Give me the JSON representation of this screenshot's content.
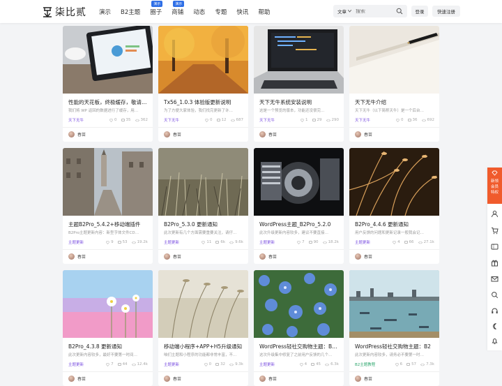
{
  "header": {
    "logo_text": "柒比贰",
    "nav": [
      {
        "label": "演示",
        "badge": ""
      },
      {
        "label": "B2主题",
        "badge": ""
      },
      {
        "label": "圈子",
        "badge": "演示"
      },
      {
        "label": "商铺",
        "badge": "演示"
      },
      {
        "label": "动态",
        "badge": ""
      },
      {
        "label": "专题",
        "badge": ""
      },
      {
        "label": "快讯",
        "badge": ""
      },
      {
        "label": "帮助",
        "badge": ""
      }
    ],
    "search": {
      "type": "文章",
      "placeholder": "搜索"
    },
    "login": "登录",
    "register": "快速注册"
  },
  "cards": [
    {
      "title": "性能的天花板，终极缓存，敬请期待！",
      "desc": "我们将 WP 返回的数据进行了缓存，用…",
      "cat": "天下无牛",
      "stats": [
        "0",
        "35",
        "362"
      ],
      "author": "春苗",
      "thumb": "tablet"
    },
    {
      "title": "Tx56_1.0.3 体验版更新说明",
      "desc": "为了方便大家体验，我们找完更新了许…",
      "cat": "天下无牛",
      "stats": [
        "0",
        "12",
        "687"
      ],
      "author": "春苗",
      "thumb": "autumn"
    },
    {
      "title": "天下无牛系统安装说明",
      "desc": "这是一个预览的版本，功能还没很完…",
      "cat": "天下无牛",
      "stats": [
        "1",
        "29",
        "290"
      ],
      "author": "春苗",
      "thumb": "laptop"
    },
    {
      "title": "天下无牛介绍",
      "desc": "天下无牛（以下简称天牛）是一个后台…",
      "cat": "天下无牛",
      "stats": [
        "0",
        "36",
        "692"
      ],
      "author": "春苗",
      "thumb": "paper"
    },
    {
      "title": "主题B2Pro_5.4.2+移动端插件",
      "desc": "B2Pro主题更新内容：新型字体文件CD…",
      "cat": "主题更新",
      "stats": [
        "9",
        "53",
        "19.2k"
      ],
      "author": "春苗",
      "thumb": "street"
    },
    {
      "title": "B2Pro_5.3.0 更新通知",
      "desc": "此次更新有几个方面需要重要关注，请仔…",
      "cat": "主题更新",
      "stats": [
        "11",
        "6k",
        "9.6k"
      ],
      "author": "春苗",
      "thumb": "grass"
    },
    {
      "title": "WordPress主题_B2Pro_5.2.0",
      "desc": "此次升级更新内容较多，建议不要直接…",
      "cat": "主题更新",
      "stats": [
        "7",
        "90",
        "18.2k"
      ],
      "author": "春苗",
      "thumb": "engine"
    },
    {
      "title": "B2Pro_4.4.6 更新通知",
      "desc": "用户反馈的问题和更新记录一般我会记…",
      "cat": "主题更新",
      "stats": [
        "4",
        "66",
        "27.1k"
      ],
      "author": "春苗",
      "thumb": "wheat"
    },
    {
      "title": "B2Pro_4.3.8 更新通知",
      "desc": "此次更新内容较多，最好不要第一时间…",
      "cat": "主题更新",
      "stats": [
        "7",
        "44",
        "12.4k"
      ],
      "author": "春苗",
      "thumb": "flower"
    },
    {
      "title": "移动端小程序+APP+H5升级通知",
      "desc": "咱们主题和小程序的功能都非常丰富，不…",
      "cat": "主题更新",
      "stats": [
        "0",
        "32",
        "9.3k"
      ],
      "author": "春苗",
      "thumb": "reed"
    },
    {
      "title": "WordPress轻社交购物主题：B2Pro",
      "desc": "这次升级集中修复了之前用户反馈的几个…",
      "cat": "主题更新",
      "stats": [
        "4",
        "45",
        "6.3k"
      ],
      "author": "春苗",
      "thumb": "blue"
    },
    {
      "title": "WordPress轻社交购物主题：B2",
      "desc": "此次更新内容较多，请务必不要第一时…",
      "cat": "B2主题教程",
      "stats": [
        "6",
        "57",
        "7.3k"
      ],
      "author": "春苗",
      "thumb": "sea"
    }
  ],
  "sidebar": {
    "vip_label": "新领会员特权"
  },
  "colors": {
    "accent": "#f05b2c",
    "category": "#7a4ee0",
    "badge": "#2f6fe6"
  }
}
